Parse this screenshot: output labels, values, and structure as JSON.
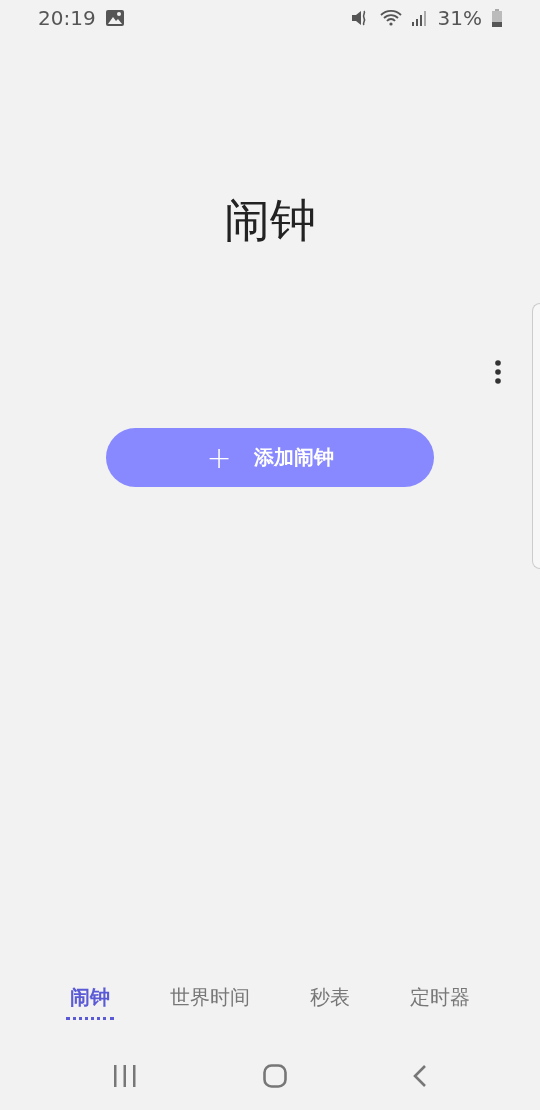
{
  "status_bar": {
    "time": "20:19",
    "battery": "31%"
  },
  "title": "闹钟",
  "add_button": {
    "icon": "+",
    "label": "添加闹钟"
  },
  "tabs": [
    {
      "label": "闹钟",
      "selected": true
    },
    {
      "label": "世界时间",
      "selected": false
    },
    {
      "label": "秒表",
      "selected": false
    },
    {
      "label": "定时器",
      "selected": false
    }
  ]
}
